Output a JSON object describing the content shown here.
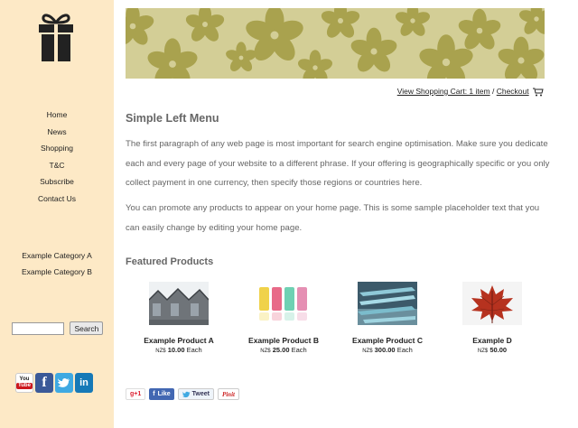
{
  "sidebar": {
    "nav": [
      "Home",
      "News",
      "Shopping",
      "T&C",
      "Subscribe",
      "Contact Us"
    ],
    "categories": [
      "Example Category A",
      "Example Category B"
    ],
    "search_button": "Search",
    "search_value": ""
  },
  "social_icons": [
    "youtube-icon",
    "facebook-icon",
    "twitter-icon",
    "linkedin-icon"
  ],
  "youtube_text": {
    "you": "You",
    "tube": "Tube"
  },
  "cart": {
    "view_label": "View Shopping Cart: 1 item",
    "separator": "/",
    "checkout_label": "Checkout"
  },
  "main": {
    "title": "Simple Left Menu",
    "p1": "The first paragraph of any web page is most important for search engine optimisation. Make sure you dedicate each and every page of your website to a different phrase. If your offering is geographically specific or you only collect payment in one currency, then specify those regions or countries here.",
    "p2": "You can promote any products to appear on your home page. This is some sample placeholder text that you can easily change by editing your home page.",
    "featured_title": "Featured Products"
  },
  "products": [
    {
      "name": "Example Product A",
      "currency": "NZ$",
      "amount": "10.00",
      "suffix": "Each"
    },
    {
      "name": "Example Product B",
      "currency": "NZ$",
      "amount": "25.00",
      "suffix": "Each"
    },
    {
      "name": "Example Product C",
      "currency": "NZ$",
      "amount": "300.00",
      "suffix": "Each"
    },
    {
      "name": "Example D",
      "currency": "NZ$",
      "amount": "50.00",
      "suffix": ""
    }
  ],
  "share": {
    "gplus": "g+1",
    "fb": "Like",
    "tweet": "Tweet",
    "pin": "Pinit"
  },
  "colors": {
    "sidebar": "#fde9c6",
    "banner": "#d3ce96",
    "flower": "#a9a24e",
    "text": "#666666"
  }
}
